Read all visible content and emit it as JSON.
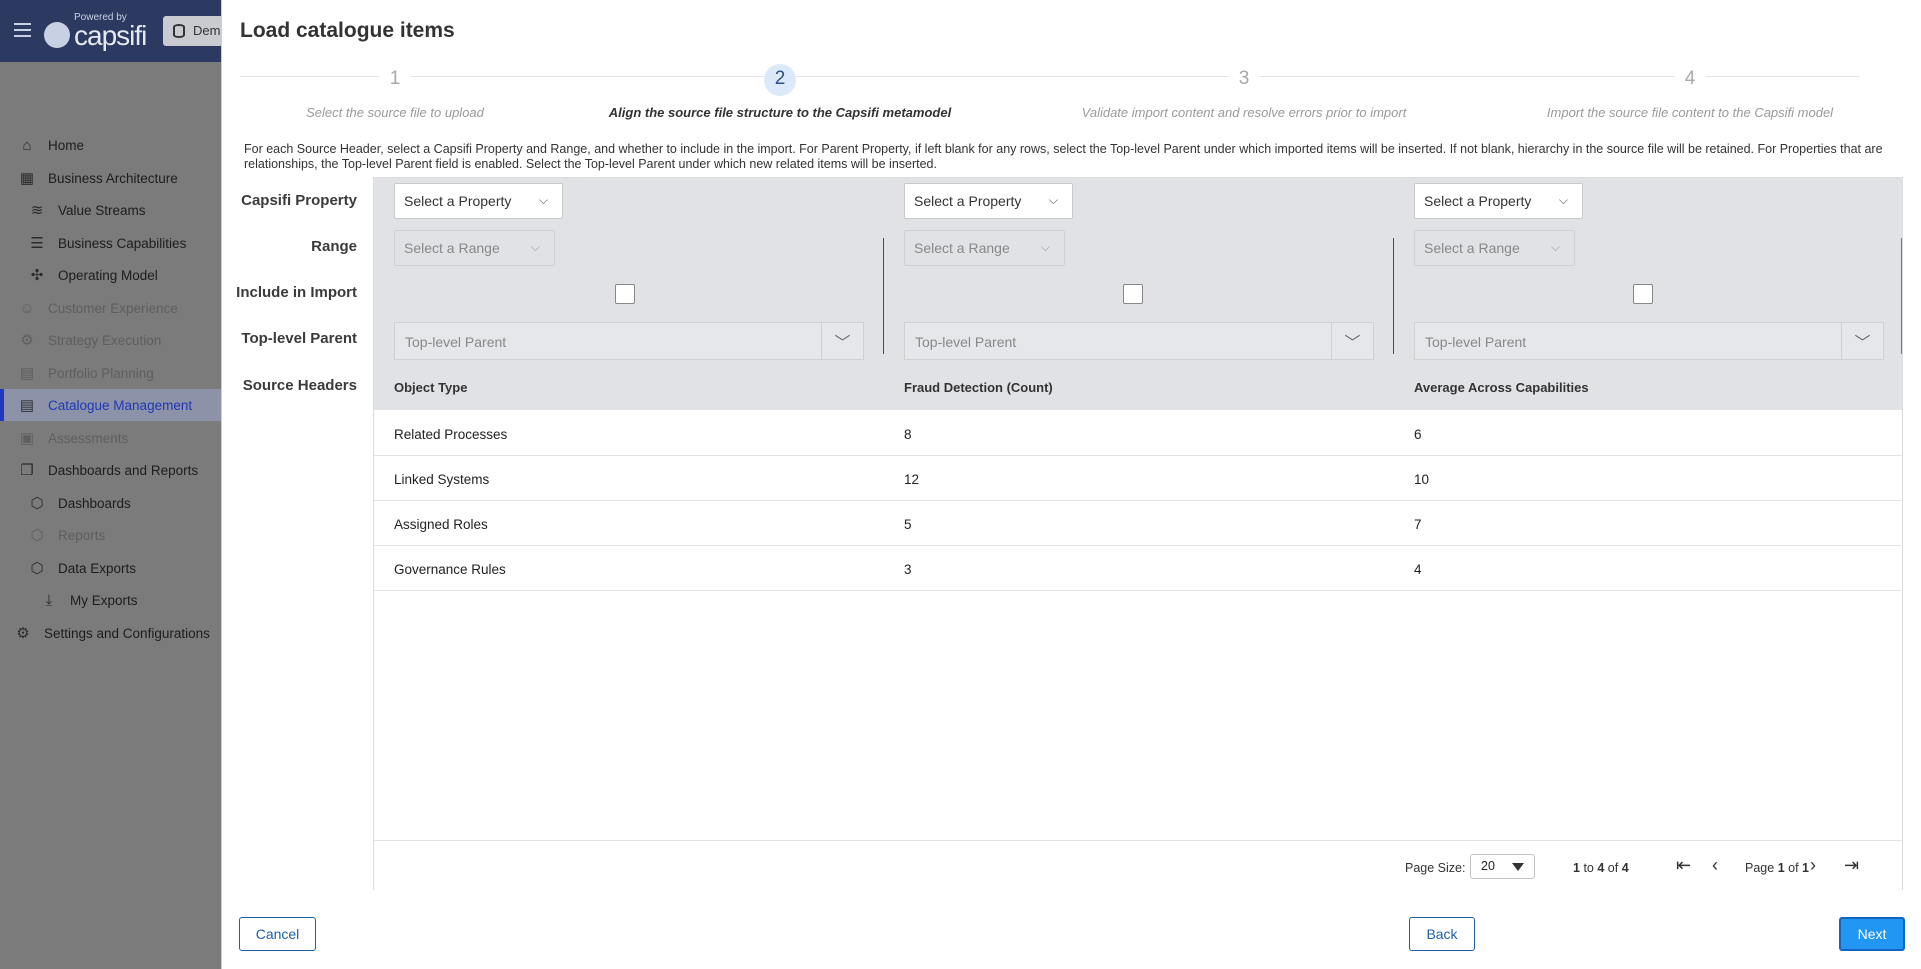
{
  "app": {
    "powered_by": "Powered by",
    "logo": "capsifi",
    "env_label": "Dem"
  },
  "sidebar": {
    "items": [
      {
        "label": "Home",
        "icon": "home-icon"
      },
      {
        "label": "Business Architecture",
        "icon": "building-icon"
      },
      {
        "label": "Value Streams",
        "icon": "value-stream-icon"
      },
      {
        "label": "Business Capabilities",
        "icon": "stack-icon"
      },
      {
        "label": "Operating Model",
        "icon": "network-icon"
      },
      {
        "label": "Customer Experience",
        "icon": "customer-icon"
      },
      {
        "label": "Strategy Execution",
        "icon": "strategy-icon"
      },
      {
        "label": "Portfolio Planning",
        "icon": "portfolio-icon"
      },
      {
        "label": "Catalogue Management",
        "icon": "catalogue-icon"
      },
      {
        "label": "Assessments",
        "icon": "assessment-icon"
      },
      {
        "label": "Dashboards and Reports",
        "icon": "dashboards-icon"
      },
      {
        "label": "Dashboards",
        "icon": "cube-icon"
      },
      {
        "label": "Reports",
        "icon": "cube-icon"
      },
      {
        "label": "Data Exports",
        "icon": "cube-icon"
      },
      {
        "label": "My Exports",
        "icon": "download-icon"
      },
      {
        "label": "Settings and Configurations",
        "icon": "gear-icon"
      }
    ]
  },
  "modal": {
    "title": "Load catalogue items",
    "steps": [
      {
        "num": "1",
        "label": "Select the source file to upload"
      },
      {
        "num": "2",
        "label": "Align the source file structure to the Capsifi metamodel"
      },
      {
        "num": "3",
        "label": "Validate import content and resolve errors prior to import"
      },
      {
        "num": "4",
        "label": "Import the source file content to the Capsifi model"
      }
    ],
    "description": "For each Source Header, select a Capsifi Property and Range, and whether to include in the import. For Parent Property, if left blank for any rows, select the Top-level Parent under which imported items will be inserted. If not blank, hierarchy in the source file will be retained. For Properties that are relationships, the Top-level Parent field is enabled. Select the Top-level Parent under which new related items will be inserted.",
    "row_labels": {
      "property": "Capsifi Property",
      "range": "Range",
      "include": "Include in Import",
      "parent": "Top-level Parent",
      "headers": "Source Headers"
    },
    "mapping": {
      "property_placeholder": "Select a Property",
      "range_placeholder": "Select a Range",
      "parent_placeholder": "Top-level Parent"
    },
    "columns": [
      "Object Type",
      "Fraud Detection (Count)",
      "Average Across Capabilities"
    ],
    "rows": [
      [
        "Related Processes",
        "8",
        "6"
      ],
      [
        "Linked Systems",
        "12",
        "10"
      ],
      [
        "Assigned Roles",
        "5",
        "7"
      ],
      [
        "Governance Rules",
        "3",
        "4"
      ]
    ],
    "pager": {
      "page_size_label": "Page Size:",
      "page_size": "20",
      "range_from": "1",
      "range_to": "4",
      "total": "4",
      "to_word": "to",
      "of_word": "of",
      "page_word": "Page",
      "page": "1",
      "pages": "1"
    },
    "buttons": {
      "cancel": "Cancel",
      "back": "Back",
      "next": "Next"
    }
  }
}
